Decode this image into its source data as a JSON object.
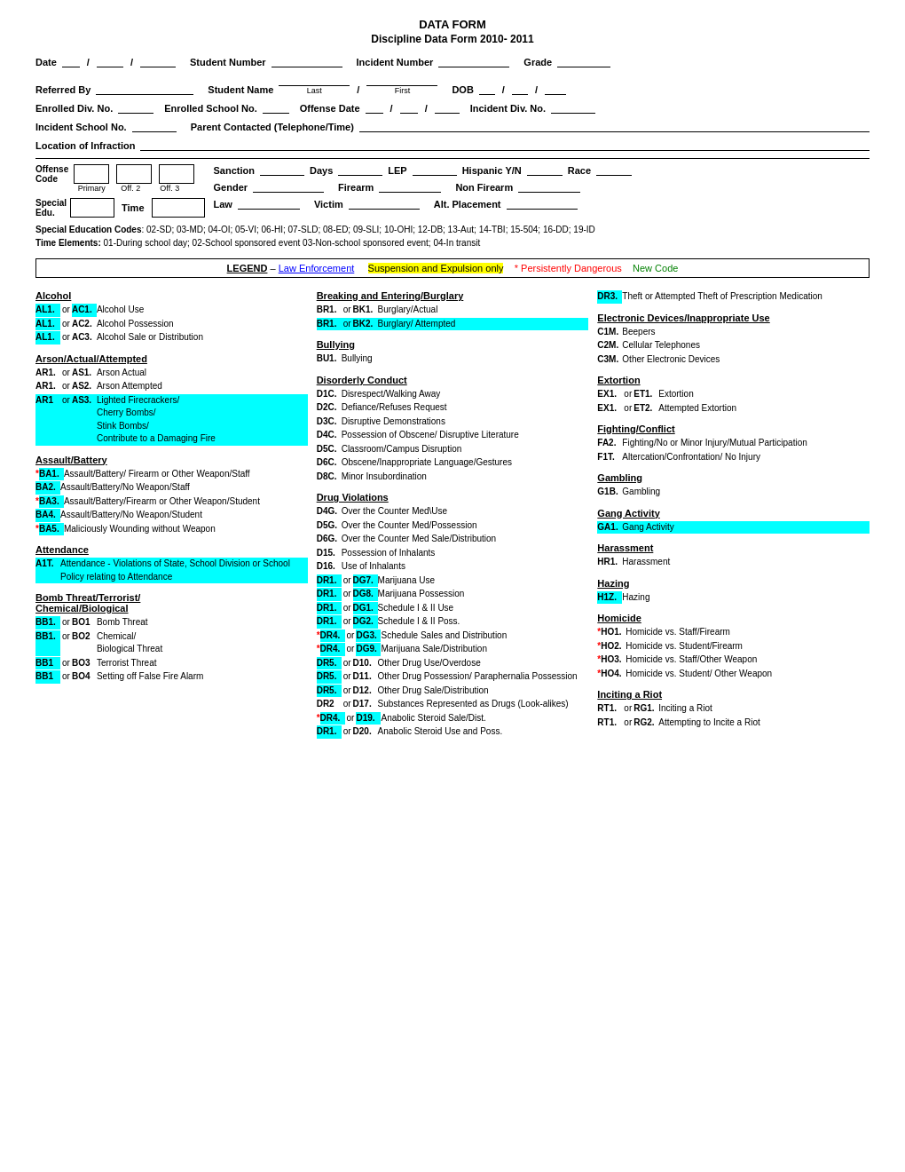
{
  "title": "DATA FORM",
  "subtitle": "Discipline Data Form 2010- 2011",
  "form": {
    "date_label": "Date",
    "student_number_label": "Student Number",
    "incident_number_label": "Incident Number",
    "grade_label": "Grade",
    "referred_by_label": "Referred By",
    "student_name_label": "Student Name",
    "dob_label": "DOB",
    "last_label": "Last",
    "first_label": "First",
    "enrolled_div_label": "Enrolled Div. No.",
    "enrolled_school_label": "Enrolled School No.",
    "offense_date_label": "Offense Date",
    "incident_div_label": "Incident Div. No.",
    "incident_school_label": "Incident School No.",
    "parent_contacted_label": "Parent Contacted (Telephone/Time)",
    "location_label": "Location of Infraction",
    "offense_code_label": "Offense\nCode",
    "primary_label": "Primary",
    "off2_label": "Off. 2",
    "off3_label": "Off. 3",
    "sanction_label": "Sanction",
    "days_label": "Days",
    "lep_label": "LEP",
    "hispanic_label": "Hispanic Y/N",
    "race_label": "Race",
    "gender_label": "Gender",
    "firearm_label": "Firearm",
    "non_firearm_label": "Non Firearm",
    "special_edu_label": "Special\nEdu.",
    "time_label": "Time",
    "law_label": "Law",
    "victim_label": "Victim",
    "alt_placement_label": "Alt. Placement"
  },
  "special_codes": {
    "label": "Special Education Codes",
    "codes": "02-SD; 03-MD; 04-OI; 05-VI; 06-HI; 07-SLD; 08-ED; 09-SLI; 10-OHI; 12-DB; 13-Aut; 14-TBI; 15-504; 16-DD; 19-ID",
    "time_label": "Time Elements:",
    "time_codes": "01-During school day; 02-School sponsored event 03-Non-school sponsored event; 04-In transit"
  },
  "legend": {
    "label": "LEGEND",
    "law_enforcement": "Law Enforcement",
    "suspension": "Suspension and Expulsion only",
    "persistently_dangerous": "* Persistently Dangerous",
    "new_code": "New Code"
  },
  "offenses": {
    "alcohol": {
      "title": "Alcohol",
      "items": [
        {
          "codes": [
            "AL1",
            "AC1"
          ],
          "cyan": [
            true,
            true
          ],
          "sep": "or",
          "desc": "Alcohol Use"
        },
        {
          "codes": [
            "AL1",
            "AC2"
          ],
          "cyan": [
            true,
            false
          ],
          "sep": "or",
          "desc": "Alcohol Possession"
        },
        {
          "codes": [
            "AL1",
            "AC3"
          ],
          "cyan": [
            true,
            false
          ],
          "sep": "or",
          "desc": "Alcohol Sale or Distribution"
        }
      ]
    },
    "arson": {
      "title": "Arson/Actual/Attempted",
      "items": [
        {
          "codes": [
            "AR1",
            "AS1"
          ],
          "cyan": [
            false,
            false
          ],
          "sep": "or",
          "desc": "Arson Actual"
        },
        {
          "codes": [
            "AR1",
            "AS2"
          ],
          "cyan": [
            false,
            false
          ],
          "sep": "or",
          "desc": "Arson Attempted"
        },
        {
          "codes": [
            "AR1",
            "AS3"
          ],
          "cyan": [
            false,
            false
          ],
          "sep": "or",
          "desc": "Lighted Firecrackers/ Cherry Bombs/ Stink Bombs/ Contribute to a Damaging Fire",
          "row_cyan": true
        }
      ]
    },
    "assault": {
      "title": "Assault/Battery",
      "items": [
        {
          "star": true,
          "codes": [
            "BA1"
          ],
          "cyan": [
            true
          ],
          "sep": "",
          "desc": "Assault/Battery/ Firearm or Other Weapon/Staff"
        },
        {
          "codes": [
            "BA2"
          ],
          "cyan": [
            true
          ],
          "sep": "",
          "desc": "Assault/Battery/No Weapon/Staff"
        },
        {
          "star": true,
          "codes": [
            "BA3"
          ],
          "cyan": [
            true
          ],
          "sep": "",
          "desc": "Assault/Battery/Firearm or Other Weapon/Student"
        },
        {
          "codes": [
            "BA4"
          ],
          "cyan": [
            true
          ],
          "sep": "",
          "desc": "Assault/Battery/No Weapon/Student"
        },
        {
          "star": true,
          "codes": [
            "BA5"
          ],
          "cyan": [
            true
          ],
          "sep": "",
          "desc": "Maliciously Wounding without Weapon"
        }
      ]
    },
    "attendance": {
      "title": "Attendance",
      "items": [
        {
          "codes": [
            "A1T"
          ],
          "cyan": [
            false
          ],
          "sep": "",
          "desc": "Attendance - Violations of State, School Division or School Policy relating to Attendance",
          "row_cyan": true
        }
      ]
    },
    "bomb": {
      "title": "Bomb Threat/Terrorist/\nChemical/Biological",
      "items": [
        {
          "codes": [
            "BB1",
            "BO1"
          ],
          "cyan": [
            true,
            false
          ],
          "sep": "or",
          "desc": "Bomb Threat"
        },
        {
          "codes": [
            "BB1",
            "BO2"
          ],
          "cyan": [
            true,
            false
          ],
          "sep": "or",
          "desc": "Chemical/Biological Threat"
        },
        {
          "codes": [
            "BB1",
            "BO3"
          ],
          "cyan": [
            true,
            false
          ],
          "sep": "or",
          "desc": "Terrorist Threat"
        },
        {
          "codes": [
            "BB1",
            "BO4"
          ],
          "cyan": [
            true,
            false
          ],
          "sep": "or",
          "desc": "Setting off False Fire Alarm"
        }
      ]
    },
    "breaking": {
      "title": "Breaking and Entering/Burglary",
      "items": [
        {
          "codes": [
            "BR1",
            "BK1"
          ],
          "cyan": [
            false,
            false
          ],
          "sep": "or",
          "desc": "Burglary/Actual"
        },
        {
          "codes": [
            "BR1",
            "BK2"
          ],
          "cyan": [
            false,
            false
          ],
          "sep": "or",
          "desc": "Burglary/ Attempted",
          "desc_cyan": true
        }
      ]
    },
    "bullying": {
      "title": "Bullying",
      "items": [
        {
          "codes": [
            "BU1"
          ],
          "cyan": [
            false
          ],
          "sep": "",
          "desc": "Bullying"
        }
      ]
    },
    "disorderly": {
      "title": "Disorderly Conduct",
      "items": [
        {
          "codes": [
            "D1C"
          ],
          "cyan": [
            false
          ],
          "sep": "",
          "desc": "Disrespect/Walking Away"
        },
        {
          "codes": [
            "D2C"
          ],
          "cyan": [
            false
          ],
          "sep": "",
          "desc": "Defiance/Refuses Request"
        },
        {
          "codes": [
            "D3C"
          ],
          "cyan": [
            false
          ],
          "sep": "",
          "desc": "Disruptive Demonstrations"
        },
        {
          "codes": [
            "D4C"
          ],
          "cyan": [
            false
          ],
          "sep": "",
          "desc": "Possession of Obscene/ Disruptive Literature"
        },
        {
          "codes": [
            "D5C"
          ],
          "cyan": [
            false
          ],
          "sep": "",
          "desc": "Classroom/Campus Disruption"
        },
        {
          "codes": [
            "D6C"
          ],
          "cyan": [
            false
          ],
          "sep": "",
          "desc": "Obscene/Inappropriate Language/Gestures"
        },
        {
          "codes": [
            "D8C"
          ],
          "cyan": [
            false
          ],
          "sep": "",
          "desc": "Minor Insubordination"
        }
      ]
    },
    "drug": {
      "title": "Drug Violations",
      "items": [
        {
          "codes": [
            "D4G"
          ],
          "cyan": [
            false
          ],
          "sep": "",
          "desc": "Over the Counter Med\\Use"
        },
        {
          "codes": [
            "D5G"
          ],
          "cyan": [
            false
          ],
          "sep": "",
          "desc": "Over the Counter Med/Possession"
        },
        {
          "codes": [
            "D6G"
          ],
          "cyan": [
            false
          ],
          "sep": "",
          "desc": "Over the Counter Med Sale/Distribution"
        },
        {
          "codes": [
            "D15"
          ],
          "cyan": [
            false
          ],
          "sep": "",
          "desc": "Possession of Inhalants"
        },
        {
          "codes": [
            "D16"
          ],
          "cyan": [
            false
          ],
          "sep": "",
          "desc": "Use of Inhalants"
        },
        {
          "codes": [
            "DR1",
            "DG7"
          ],
          "cyan": [
            true,
            true
          ],
          "sep": "or",
          "desc": "Marijuana Use"
        },
        {
          "codes": [
            "DR1",
            "DG8"
          ],
          "cyan": [
            true,
            true
          ],
          "sep": "or",
          "desc": "Marijuana Possession"
        },
        {
          "codes": [
            "DR1",
            "DG1"
          ],
          "cyan": [
            true,
            true
          ],
          "sep": "or",
          "desc": "Schedule I & II Use"
        },
        {
          "codes": [
            "DR1",
            "DG2"
          ],
          "cyan": [
            true,
            true
          ],
          "sep": "or",
          "desc": "Schedule I & II Poss."
        },
        {
          "star": true,
          "codes": [
            "DR4",
            "DG3"
          ],
          "cyan": [
            true,
            true
          ],
          "sep": "or",
          "desc": "Schedule Sales and Distribution"
        },
        {
          "star": true,
          "codes": [
            "DR4",
            "DG9"
          ],
          "cyan": [
            true,
            true
          ],
          "sep": "or",
          "desc": "Marijuana Sale/Distribution"
        },
        {
          "codes": [
            "DR5",
            "D10"
          ],
          "cyan": [
            true,
            false
          ],
          "sep": "or",
          "desc": "Other Drug Use/Overdose"
        },
        {
          "codes": [
            "DR5",
            "D11"
          ],
          "cyan": [
            true,
            false
          ],
          "sep": "or",
          "desc": "Other Drug Possession/ Paraphernalia Possession"
        },
        {
          "codes": [
            "DR5",
            "D12"
          ],
          "cyan": [
            true,
            false
          ],
          "sep": "or",
          "desc": "Other Drug Sale/Distribution"
        },
        {
          "codes": [
            "DR2",
            "D17"
          ],
          "cyan": [
            false,
            false
          ],
          "sep": "or",
          "desc": "Substances Represented as Drugs (Look-alikes)"
        },
        {
          "star": true,
          "codes": [
            "DR4",
            "D19"
          ],
          "cyan": [
            true,
            true
          ],
          "sep": "or",
          "desc": "Anabolic Steroid Sale/Dist."
        },
        {
          "codes": [
            "DR1",
            "D20"
          ],
          "cyan": [
            true,
            false
          ],
          "sep": "or",
          "desc": "Anabolic Steroid Use and Poss."
        }
      ]
    },
    "dr3": {
      "items": [
        {
          "codes": [
            "DR3"
          ],
          "cyan": [
            true
          ],
          "sep": "",
          "desc": "Theft or Attempted Theft of Prescription Medication"
        }
      ]
    },
    "electronic": {
      "title": "Electronic Devices/Inappropriate Use",
      "items": [
        {
          "codes": [
            "C1M"
          ],
          "cyan": [
            false
          ],
          "sep": "",
          "desc": "Beepers"
        },
        {
          "codes": [
            "C2M"
          ],
          "cyan": [
            false
          ],
          "sep": "",
          "desc": "Cellular Telephones"
        },
        {
          "codes": [
            "C3M"
          ],
          "cyan": [
            false
          ],
          "sep": "",
          "desc": "Other Electronic Devices"
        }
      ]
    },
    "extortion": {
      "title": "Extortion",
      "items": [
        {
          "codes": [
            "EX1",
            "ET1"
          ],
          "cyan": [
            false,
            false
          ],
          "sep": "or",
          "desc": "Extortion"
        },
        {
          "codes": [
            "EX1",
            "ET2"
          ],
          "cyan": [
            false,
            false
          ],
          "sep": "or",
          "desc": "Attempted Extortion"
        }
      ]
    },
    "fighting": {
      "title": "Fighting/Conflict",
      "items": [
        {
          "codes": [
            "FA2"
          ],
          "cyan": [
            false
          ],
          "sep": "",
          "desc": "Fighting/No or Minor Injury/Mutual Participation"
        },
        {
          "codes": [
            "F1T"
          ],
          "cyan": [
            false
          ],
          "sep": "",
          "desc": "Altercation/Confrontation/ No Injury"
        }
      ]
    },
    "gambling": {
      "title": "Gambling",
      "items": [
        {
          "codes": [
            "G1B"
          ],
          "cyan": [
            false
          ],
          "sep": "",
          "desc": "Gambling"
        }
      ]
    },
    "gang": {
      "title": "Gang Activity",
      "items": [
        {
          "codes": [
            "GA1"
          ],
          "cyan": [
            false
          ],
          "sep": "",
          "desc": "Gang Activity",
          "row_cyan": true
        }
      ]
    },
    "harassment": {
      "title": "Harassment",
      "items": [
        {
          "codes": [
            "HR1"
          ],
          "cyan": [
            false
          ],
          "sep": "",
          "desc": "Harassment"
        }
      ]
    },
    "hazing": {
      "title": "Hazing",
      "items": [
        {
          "codes": [
            "H1Z"
          ],
          "cyan": [
            true
          ],
          "sep": "",
          "desc": "Hazing"
        }
      ]
    },
    "homicide": {
      "title": "Homicide",
      "items": [
        {
          "star": true,
          "codes": [
            "HO1"
          ],
          "cyan": [
            false
          ],
          "sep": "",
          "desc": "Homicide vs. Staff/Firearm"
        },
        {
          "star": true,
          "codes": [
            "HO2"
          ],
          "cyan": [
            false
          ],
          "sep": "",
          "desc": "Homicide vs. Student/Firearm"
        },
        {
          "star": true,
          "codes": [
            "HO3"
          ],
          "cyan": [
            false
          ],
          "sep": "",
          "desc": "Homicide vs. Staff/Other Weapon"
        },
        {
          "star": true,
          "codes": [
            "HO4"
          ],
          "cyan": [
            false
          ],
          "sep": "",
          "desc": "Homicide vs. Student/ Other Weapon"
        }
      ]
    },
    "inciting": {
      "title": "Inciting a Riot",
      "items": [
        {
          "codes": [
            "RT1",
            "RG1"
          ],
          "cyan": [
            false,
            false
          ],
          "sep": "or",
          "desc": "Inciting a Riot"
        },
        {
          "codes": [
            "RT1",
            "RG2"
          ],
          "cyan": [
            false,
            false
          ],
          "sep": "or",
          "desc": "Attempting to Incite a Riot"
        }
      ]
    }
  }
}
